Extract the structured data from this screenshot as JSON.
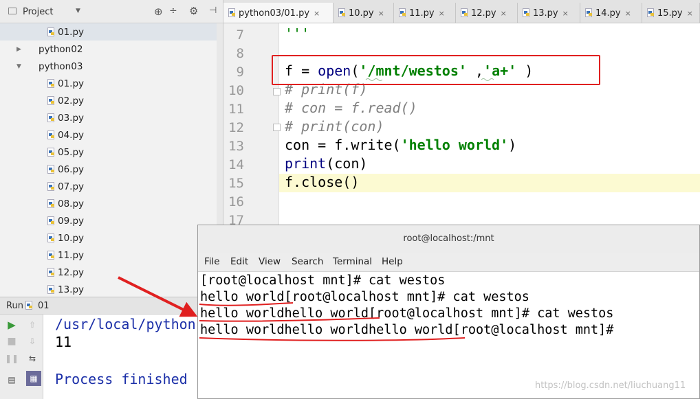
{
  "project_panel": {
    "title": "Project",
    "tree": [
      {
        "label": "01.py",
        "kind": "file",
        "indent": 1
      },
      {
        "label": "python02",
        "kind": "folder",
        "indent": 0,
        "expanded": false
      },
      {
        "label": "python03",
        "kind": "folder",
        "indent": 0,
        "expanded": true
      },
      {
        "label": "01.py",
        "kind": "file",
        "indent": 1
      },
      {
        "label": "02.py",
        "kind": "file",
        "indent": 1
      },
      {
        "label": "03.py",
        "kind": "file",
        "indent": 1
      },
      {
        "label": "04.py",
        "kind": "file",
        "indent": 1
      },
      {
        "label": "05.py",
        "kind": "file",
        "indent": 1
      },
      {
        "label": "06.py",
        "kind": "file",
        "indent": 1
      },
      {
        "label": "07.py",
        "kind": "file",
        "indent": 1
      },
      {
        "label": "08.py",
        "kind": "file",
        "indent": 1
      },
      {
        "label": "09.py",
        "kind": "file",
        "indent": 1
      },
      {
        "label": "10.py",
        "kind": "file",
        "indent": 1
      },
      {
        "label": "11.py",
        "kind": "file",
        "indent": 1
      },
      {
        "label": "12.py",
        "kind": "file",
        "indent": 1
      },
      {
        "label": "13.py",
        "kind": "file",
        "indent": 1
      }
    ]
  },
  "tabs": [
    {
      "label": "python03/01.py",
      "active": true
    },
    {
      "label": "10.py",
      "active": false
    },
    {
      "label": "11.py",
      "active": false
    },
    {
      "label": "12.py",
      "active": false
    },
    {
      "label": "13.py",
      "active": false
    },
    {
      "label": "14.py",
      "active": false
    },
    {
      "label": "15.py",
      "active": false
    }
  ],
  "editor": {
    "line_numbers": [
      "7",
      "8",
      "9",
      "10",
      "11",
      "12",
      "13",
      "14",
      "15",
      "16",
      "17"
    ],
    "current_line": "15",
    "lines": {
      "l7": "'''",
      "l9": {
        "a": "f = ",
        "b": "open",
        "c": "(",
        "d": "'/mnt/westos'",
        "e": " ,",
        "f": "'a+'",
        "g": " )"
      },
      "l10": "# print(f)",
      "l11": "# con = f.read()",
      "l12": "# print(con)",
      "l13": {
        "a": "con = f.write(",
        "b": "'hello world'",
        "c": ")"
      },
      "l14": {
        "a": "print",
        "b": "(con)"
      },
      "l15": "f.close()"
    }
  },
  "run_panel": {
    "label": "Run",
    "config": "01",
    "output_line1": "/usr/local/python",
    "output_line2": "11",
    "output_line3": "Process finished"
  },
  "terminal": {
    "title": "root@localhost:/mnt",
    "menu": [
      "File",
      "Edit",
      "View",
      "Search",
      "Terminal",
      "Help"
    ],
    "lines": [
      "[root@localhost mnt]# cat westos",
      "hello world[root@localhost mnt]# cat westos",
      "hello worldhello world[root@localhost mnt]# cat westos",
      "hello worldhello worldhello world[root@localhost mnt]#"
    ]
  },
  "watermark": "https://blog.csdn.net/liuchuang11",
  "colors": {
    "annotation_red": "#e02020",
    "keyword_blue": "#000080",
    "string_green": "#008000",
    "comment_gray": "#808080",
    "run_output_blue": "#1b2fa8"
  }
}
